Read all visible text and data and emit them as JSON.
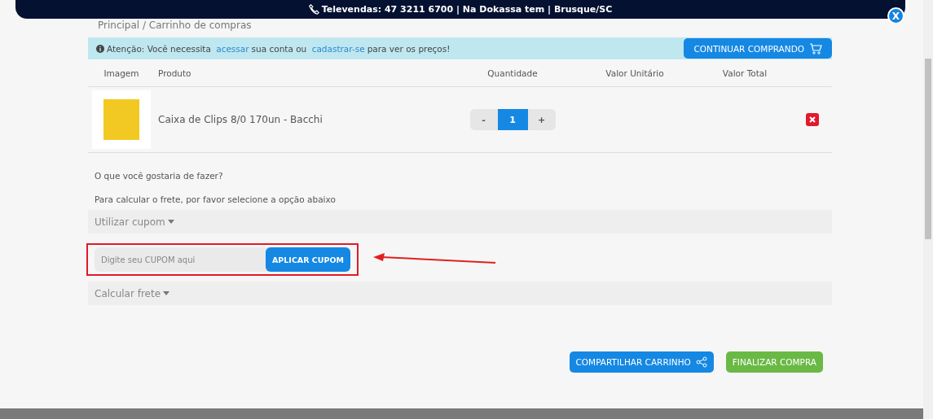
{
  "top_bar": {
    "text": "Televendas: 47 3211 6700 | Na Dokassa tem | Brusque/SC",
    "close": "X"
  },
  "breadcrumb": "Principal / Carrinho de compras",
  "notice": {
    "parts": [
      {
        "kind": "text",
        "text": "Atenção: Você necessita"
      },
      {
        "kind": "link",
        "text": "acessar"
      },
      {
        "kind": "text",
        "text": "sua conta ou"
      },
      {
        "kind": "link",
        "text": "cadastrar-se"
      },
      {
        "kind": "text",
        "text": "para ver os preços!"
      }
    ],
    "button": "CONTINUAR COMPRANDO"
  },
  "table": {
    "columns": [
      "Imagem",
      "Produto",
      "Quantidade",
      "Valor Unitário",
      "Valor Total"
    ],
    "rows": [
      {
        "product": "Caixa de Clips 8/0 170un - Bacchi",
        "minus": "-",
        "quantity": "1",
        "plus": "+"
      }
    ]
  },
  "question": "O que você gostaria de fazer?",
  "hint": "Para calcular o frete, por favor selecione a opção abaixo",
  "coupon": {
    "toggle": "Utilizar cupom",
    "expanded": true,
    "placeholder": "Digite seu CUPOM aqui",
    "button": "APLICAR CUPOM"
  },
  "shipping": {
    "toggle": "Calcular frete",
    "expanded": false
  },
  "actions": [
    {
      "kind": "share",
      "label": "COMPARTILHAR CARRINHO"
    },
    {
      "kind": "finish",
      "label": "FINALIZAR COMPRA"
    }
  ]
}
